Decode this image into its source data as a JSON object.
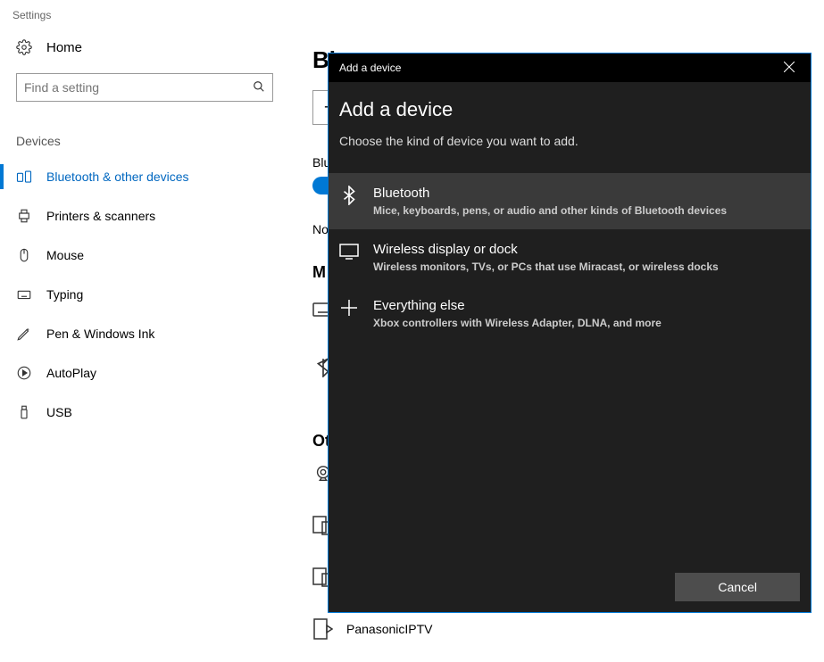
{
  "app_title": "Settings",
  "home_label": "Home",
  "search": {
    "placeholder": "Find a setting"
  },
  "section_label": "Devices",
  "nav": [
    {
      "label": "Bluetooth & other devices",
      "icon": "bt"
    },
    {
      "label": "Printers & scanners",
      "icon": "printer"
    },
    {
      "label": "Mouse",
      "icon": "mouse"
    },
    {
      "label": "Typing",
      "icon": "keyboard"
    },
    {
      "label": "Pen & Windows Ink",
      "icon": "pen"
    },
    {
      "label": "AutoPlay",
      "icon": "autoplay"
    },
    {
      "label": "USB",
      "icon": "usb"
    }
  ],
  "main": {
    "title_partial": "Bl",
    "bt_partial": "Blu",
    "discoverable_partial": "No",
    "section_mouse_partial": "M",
    "section_other_partial": "Ot",
    "device_panasonic": "PanasonicIPTV"
  },
  "modal": {
    "titlebar": "Add a device",
    "heading": "Add a device",
    "subtitle": "Choose the kind of device you want to add.",
    "choices": [
      {
        "title": "Bluetooth",
        "desc": "Mice, keyboards, pens, or audio and other kinds of Bluetooth devices"
      },
      {
        "title": "Wireless display or dock",
        "desc": "Wireless monitors, TVs, or PCs that use Miracast, or wireless docks"
      },
      {
        "title": "Everything else",
        "desc": "Xbox controllers with Wireless Adapter, DLNA, and more"
      }
    ],
    "cancel": "Cancel"
  }
}
